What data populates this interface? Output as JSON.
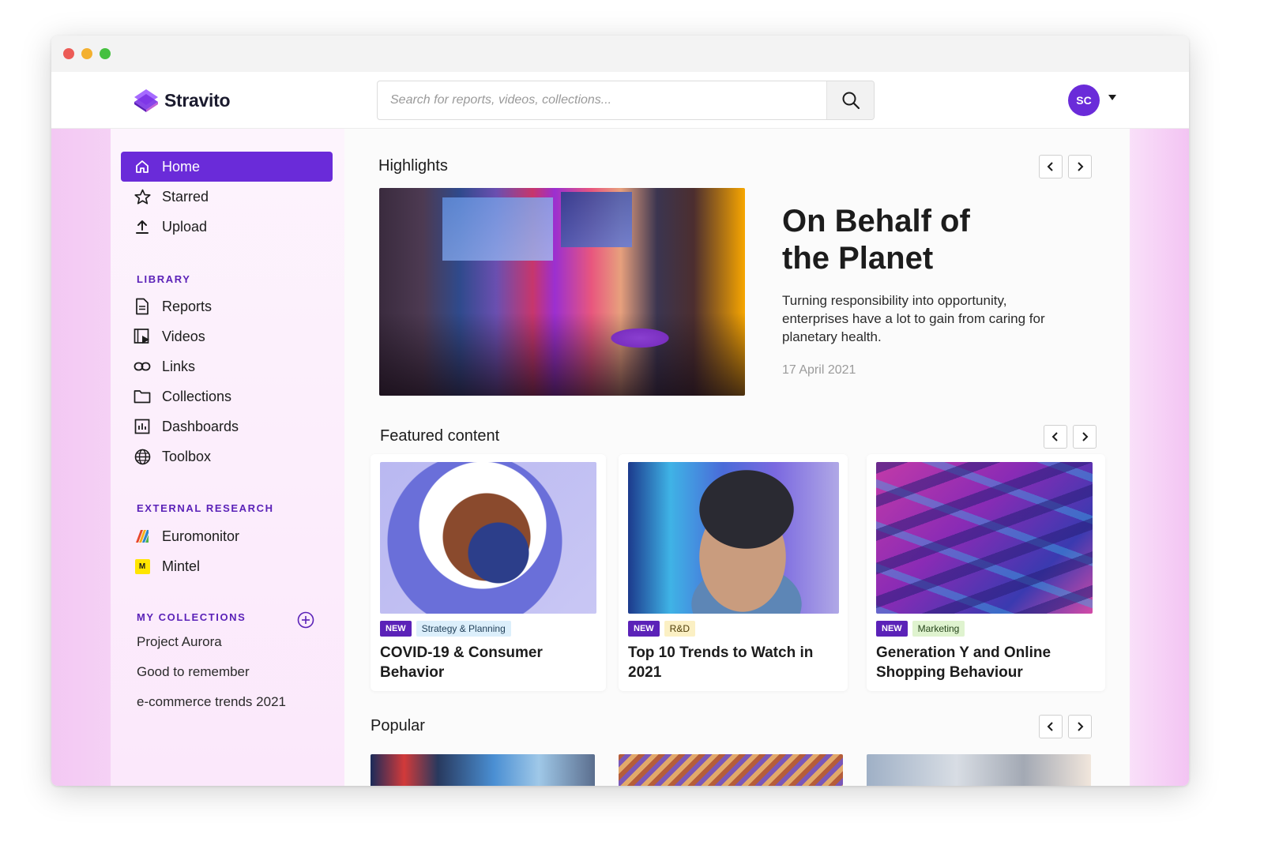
{
  "app": {
    "name": "Stravito"
  },
  "search": {
    "placeholder": "Search for reports, videos, collections..."
  },
  "user": {
    "initials": "SC"
  },
  "colors": {
    "accent": "#6a2bd9",
    "section_title": "#5b22b8",
    "tag_new": "#5b22b8"
  },
  "nav": [
    {
      "label": "Home",
      "icon": "home-icon",
      "active": true
    },
    {
      "label": "Starred",
      "icon": "star-icon"
    },
    {
      "label": "Upload",
      "icon": "upload-icon"
    }
  ],
  "library": {
    "title": "LIBRARY",
    "items": [
      {
        "label": "Reports",
        "icon": "document-icon"
      },
      {
        "label": "Videos",
        "icon": "video-icon"
      },
      {
        "label": "Links",
        "icon": "link-icon"
      },
      {
        "label": "Collections",
        "icon": "folder-icon"
      },
      {
        "label": "Dashboards",
        "icon": "dashboard-icon"
      },
      {
        "label": "Toolbox",
        "icon": "globe-icon"
      }
    ]
  },
  "external": {
    "title": "EXTERNAL RESEARCH",
    "items": [
      {
        "label": "Euromonitor",
        "icon": "euromonitor-logo-icon"
      },
      {
        "label": "Mintel",
        "icon": "mintel-logo-icon",
        "badge": "M"
      }
    ]
  },
  "collections": {
    "title": "MY COLLECTIONS",
    "items": [
      "Project Aurora",
      "Good to remember",
      "e-commerce trends 2021"
    ]
  },
  "highlights": {
    "heading": "Highlights",
    "title": "On Behalf of the Planet",
    "description": "Turning responsibility into opportunity, enterprises have a lot to gain from caring for planetary health.",
    "date": "17 April 2021"
  },
  "featured": {
    "heading": "Featured content",
    "cards": [
      {
        "new_label": "NEW",
        "tag": "Strategy & Planning",
        "title": "COVID-19 & Consumer Behavior"
      },
      {
        "new_label": "NEW",
        "tag": "R&D",
        "title": "Top 10 Trends to Watch in 2021"
      },
      {
        "new_label": "NEW",
        "tag": "Marketing",
        "title": "Generation Y and Online Shopping Behaviour"
      }
    ]
  },
  "popular": {
    "heading": "Popular"
  }
}
